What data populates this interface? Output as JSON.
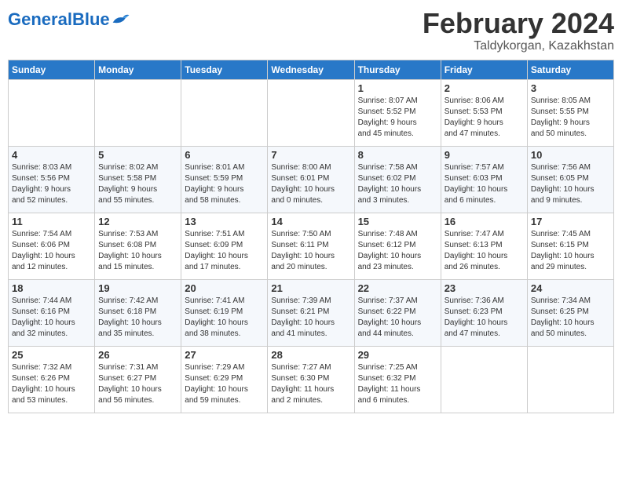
{
  "header": {
    "logo_general": "General",
    "logo_blue": "Blue",
    "month": "February 2024",
    "location": "Taldykorgan, Kazakhstan"
  },
  "days_of_week": [
    "Sunday",
    "Monday",
    "Tuesday",
    "Wednesday",
    "Thursday",
    "Friday",
    "Saturday"
  ],
  "weeks": [
    [
      {
        "day": "",
        "info": ""
      },
      {
        "day": "",
        "info": ""
      },
      {
        "day": "",
        "info": ""
      },
      {
        "day": "",
        "info": ""
      },
      {
        "day": "1",
        "info": "Sunrise: 8:07 AM\nSunset: 5:52 PM\nDaylight: 9 hours\nand 45 minutes."
      },
      {
        "day": "2",
        "info": "Sunrise: 8:06 AM\nSunset: 5:53 PM\nDaylight: 9 hours\nand 47 minutes."
      },
      {
        "day": "3",
        "info": "Sunrise: 8:05 AM\nSunset: 5:55 PM\nDaylight: 9 hours\nand 50 minutes."
      }
    ],
    [
      {
        "day": "4",
        "info": "Sunrise: 8:03 AM\nSunset: 5:56 PM\nDaylight: 9 hours\nand 52 minutes."
      },
      {
        "day": "5",
        "info": "Sunrise: 8:02 AM\nSunset: 5:58 PM\nDaylight: 9 hours\nand 55 minutes."
      },
      {
        "day": "6",
        "info": "Sunrise: 8:01 AM\nSunset: 5:59 PM\nDaylight: 9 hours\nand 58 minutes."
      },
      {
        "day": "7",
        "info": "Sunrise: 8:00 AM\nSunset: 6:01 PM\nDaylight: 10 hours\nand 0 minutes."
      },
      {
        "day": "8",
        "info": "Sunrise: 7:58 AM\nSunset: 6:02 PM\nDaylight: 10 hours\nand 3 minutes."
      },
      {
        "day": "9",
        "info": "Sunrise: 7:57 AM\nSunset: 6:03 PM\nDaylight: 10 hours\nand 6 minutes."
      },
      {
        "day": "10",
        "info": "Sunrise: 7:56 AM\nSunset: 6:05 PM\nDaylight: 10 hours\nand 9 minutes."
      }
    ],
    [
      {
        "day": "11",
        "info": "Sunrise: 7:54 AM\nSunset: 6:06 PM\nDaylight: 10 hours\nand 12 minutes."
      },
      {
        "day": "12",
        "info": "Sunrise: 7:53 AM\nSunset: 6:08 PM\nDaylight: 10 hours\nand 15 minutes."
      },
      {
        "day": "13",
        "info": "Sunrise: 7:51 AM\nSunset: 6:09 PM\nDaylight: 10 hours\nand 17 minutes."
      },
      {
        "day": "14",
        "info": "Sunrise: 7:50 AM\nSunset: 6:11 PM\nDaylight: 10 hours\nand 20 minutes."
      },
      {
        "day": "15",
        "info": "Sunrise: 7:48 AM\nSunset: 6:12 PM\nDaylight: 10 hours\nand 23 minutes."
      },
      {
        "day": "16",
        "info": "Sunrise: 7:47 AM\nSunset: 6:13 PM\nDaylight: 10 hours\nand 26 minutes."
      },
      {
        "day": "17",
        "info": "Sunrise: 7:45 AM\nSunset: 6:15 PM\nDaylight: 10 hours\nand 29 minutes."
      }
    ],
    [
      {
        "day": "18",
        "info": "Sunrise: 7:44 AM\nSunset: 6:16 PM\nDaylight: 10 hours\nand 32 minutes."
      },
      {
        "day": "19",
        "info": "Sunrise: 7:42 AM\nSunset: 6:18 PM\nDaylight: 10 hours\nand 35 minutes."
      },
      {
        "day": "20",
        "info": "Sunrise: 7:41 AM\nSunset: 6:19 PM\nDaylight: 10 hours\nand 38 minutes."
      },
      {
        "day": "21",
        "info": "Sunrise: 7:39 AM\nSunset: 6:21 PM\nDaylight: 10 hours\nand 41 minutes."
      },
      {
        "day": "22",
        "info": "Sunrise: 7:37 AM\nSunset: 6:22 PM\nDaylight: 10 hours\nand 44 minutes."
      },
      {
        "day": "23",
        "info": "Sunrise: 7:36 AM\nSunset: 6:23 PM\nDaylight: 10 hours\nand 47 minutes."
      },
      {
        "day": "24",
        "info": "Sunrise: 7:34 AM\nSunset: 6:25 PM\nDaylight: 10 hours\nand 50 minutes."
      }
    ],
    [
      {
        "day": "25",
        "info": "Sunrise: 7:32 AM\nSunset: 6:26 PM\nDaylight: 10 hours\nand 53 minutes."
      },
      {
        "day": "26",
        "info": "Sunrise: 7:31 AM\nSunset: 6:27 PM\nDaylight: 10 hours\nand 56 minutes."
      },
      {
        "day": "27",
        "info": "Sunrise: 7:29 AM\nSunset: 6:29 PM\nDaylight: 10 hours\nand 59 minutes."
      },
      {
        "day": "28",
        "info": "Sunrise: 7:27 AM\nSunset: 6:30 PM\nDaylight: 11 hours\nand 2 minutes."
      },
      {
        "day": "29",
        "info": "Sunrise: 7:25 AM\nSunset: 6:32 PM\nDaylight: 11 hours\nand 6 minutes."
      },
      {
        "day": "",
        "info": ""
      },
      {
        "day": "",
        "info": ""
      }
    ]
  ]
}
